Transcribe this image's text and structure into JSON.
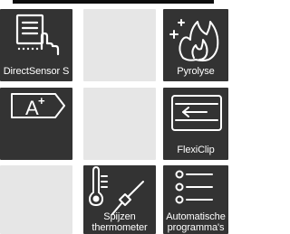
{
  "colors": {
    "tile_dark": "#333333",
    "tile_empty": "#e6e6e6",
    "icon": "#ffffff",
    "top_bar": "#0d0d0d"
  },
  "tiles": [
    {
      "id": "directsensor",
      "label": "DirectSensor S",
      "icon": "touch-list-icon"
    },
    {
      "id": "empty-1",
      "label": "",
      "icon": ""
    },
    {
      "id": "pyrolyse",
      "label": "Pyrolyse",
      "icon": "flame-sparkle-icon"
    },
    {
      "id": "energy",
      "label": "",
      "icon": "energy-label-a-plus-icon"
    },
    {
      "id": "empty-2",
      "label": "",
      "icon": ""
    },
    {
      "id": "flexiclip",
      "label": "FlexiClip",
      "icon": "rail-clip-icon"
    },
    {
      "id": "empty-3",
      "label": "",
      "icon": ""
    },
    {
      "id": "meat-thermometer",
      "label_lines": [
        "Spijzen",
        "thermometer"
      ],
      "icon": "meat-probe-icon"
    },
    {
      "id": "auto-programs",
      "label_lines": [
        "Automatische",
        "programma's"
      ],
      "icon": "program-list-icon"
    }
  ],
  "energy_label_text": "A",
  "energy_label_sup": "+"
}
